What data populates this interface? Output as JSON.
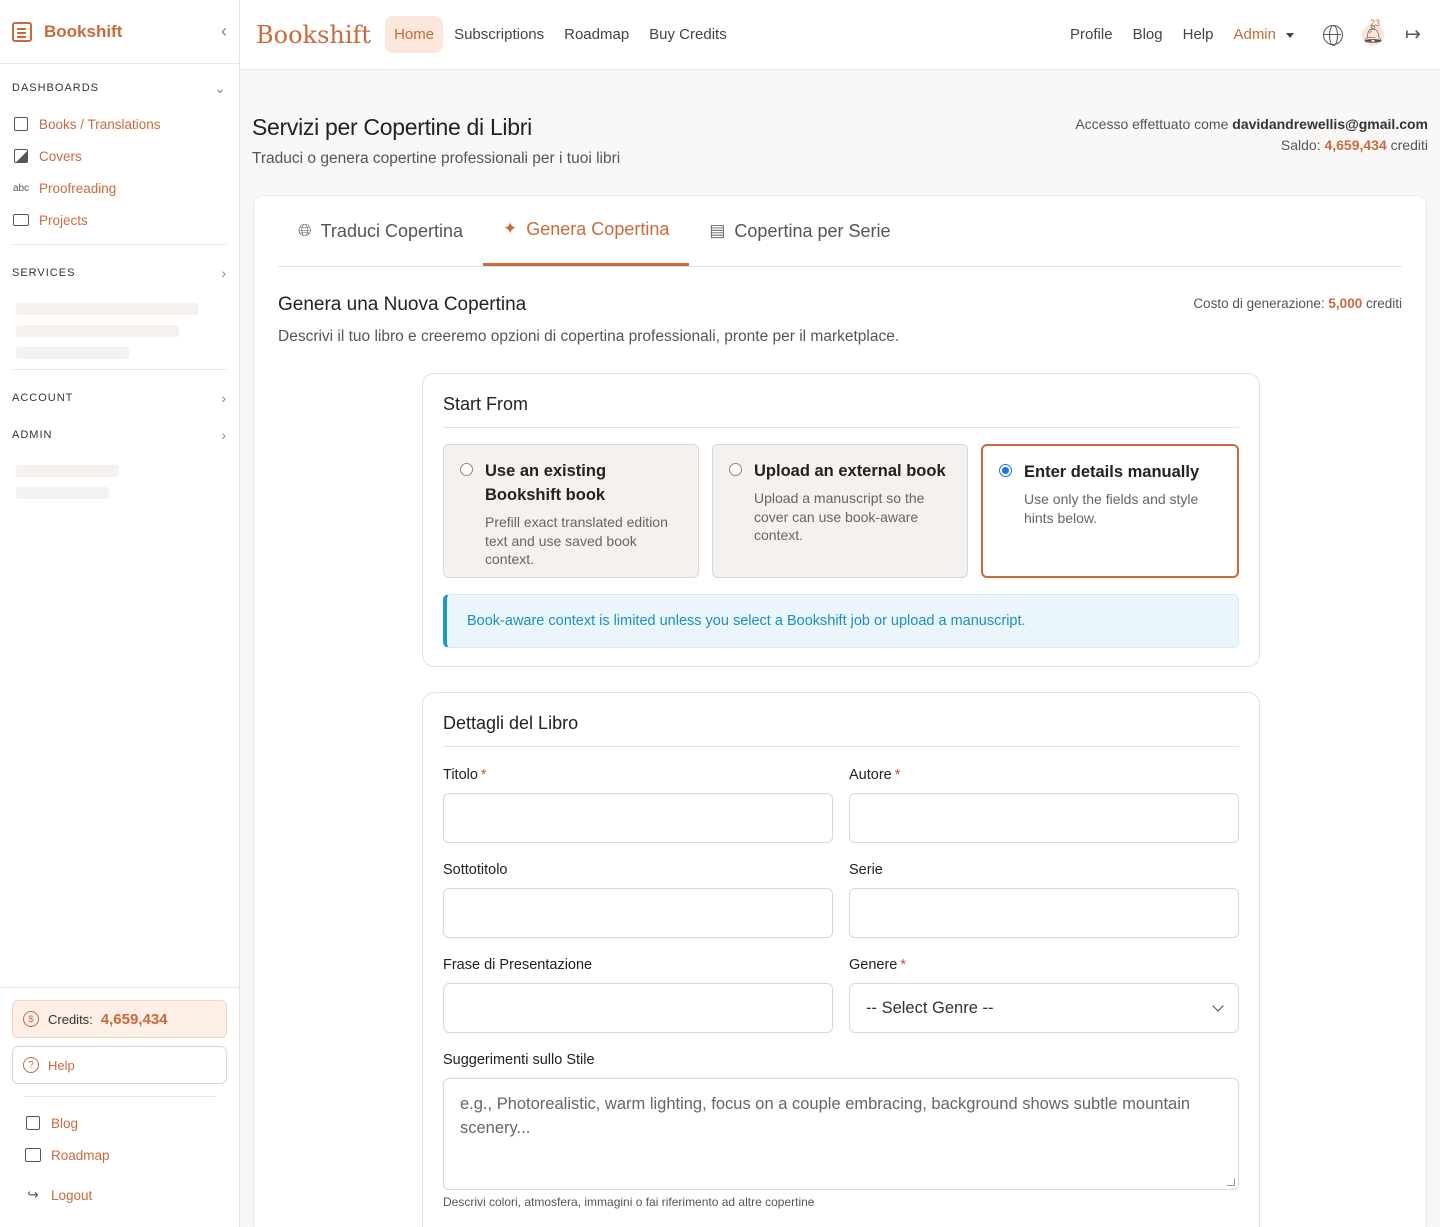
{
  "sidebar": {
    "brand": "Bookshift",
    "sections": {
      "dashboards": "DASHBOARDS",
      "services": "SERVICES",
      "account": "ACCOUNT",
      "admin": "ADMIN"
    },
    "items": [
      {
        "label": "Books / Translations",
        "icon": "book-list-icon"
      },
      {
        "label": "Covers",
        "icon": "image-icon"
      },
      {
        "label": "Proofreading",
        "icon": "spellcheck-icon"
      },
      {
        "label": "Projects",
        "icon": "folder-icon"
      }
    ],
    "credits_label": "Credits:",
    "credits_value": "4,659,434",
    "help_label": "Help",
    "links": [
      {
        "label": "Blog",
        "icon": "document-icon"
      },
      {
        "label": "Roadmap",
        "icon": "map-icon"
      },
      {
        "label": "Logout",
        "icon": "logout-icon"
      }
    ]
  },
  "topnav": {
    "brand": "Bookshift",
    "links": [
      "Home",
      "Subscriptions",
      "Roadmap",
      "Buy Credits"
    ],
    "active": "Home",
    "right_links": [
      "Profile",
      "Blog",
      "Help"
    ],
    "admin_label": "Admin",
    "notification_count": "23"
  },
  "page": {
    "title": "Servizi per Copertine di Libri",
    "subtitle": "Traduci o genera copertine professionali per i tuoi libri",
    "login_prefix": "Accesso effettuato come",
    "login_email": "davidandrewellis@gmail.com",
    "balance_prefix": "Saldo:",
    "balance_value": "4,659,434",
    "balance_suffix": "crediti"
  },
  "tabs": [
    {
      "label": "Traduci Copertina",
      "icon": "translate-icon"
    },
    {
      "label": "Genera Copertina",
      "icon": "sparkles-icon",
      "active": true
    },
    {
      "label": "Copertina per Serie",
      "icon": "stack-icon"
    }
  ],
  "generate": {
    "title": "Genera una Nuova Copertina",
    "description": "Descrivi il tuo libro e creeremo opzioni di copertina professionali, pronte per il marketplace.",
    "cost_prefix": "Costo di generazione:",
    "cost_value": "5,000",
    "cost_suffix": "crediti"
  },
  "start_from": {
    "heading": "Start From",
    "options": [
      {
        "title": "Use an existing Bookshift book",
        "desc": "Prefill exact translated edition text and use saved book context.",
        "selected": false
      },
      {
        "title": "Upload an external book",
        "desc": "Upload a manuscript so the cover can use book-aware context.",
        "selected": false
      },
      {
        "title": "Enter details manually",
        "desc": "Use only the fields and style hints below.",
        "selected": true
      }
    ],
    "alert": "Book-aware context is limited unless you select a Bookshift job or upload a manuscript."
  },
  "details": {
    "heading": "Dettagli del Libro",
    "title_label": "Titolo",
    "author_label": "Autore",
    "subtitle_label": "Sottotitolo",
    "series_label": "Serie",
    "tagline_label": "Frase di Presentazione",
    "genre_label": "Genere",
    "genre_value": "-- Select Genre --",
    "style_label": "Suggerimenti sullo Stile",
    "style_placeholder": "e.g., Photorealistic, warm lighting, focus on a couple embracing, background shows subtle mountain scenery...",
    "style_hint": "Descrivi colori, atmosfera, immagini o fai riferimento ad altre copertine"
  },
  "colors": {
    "accent": "#c96a3d",
    "info": "#1b8fc0"
  }
}
